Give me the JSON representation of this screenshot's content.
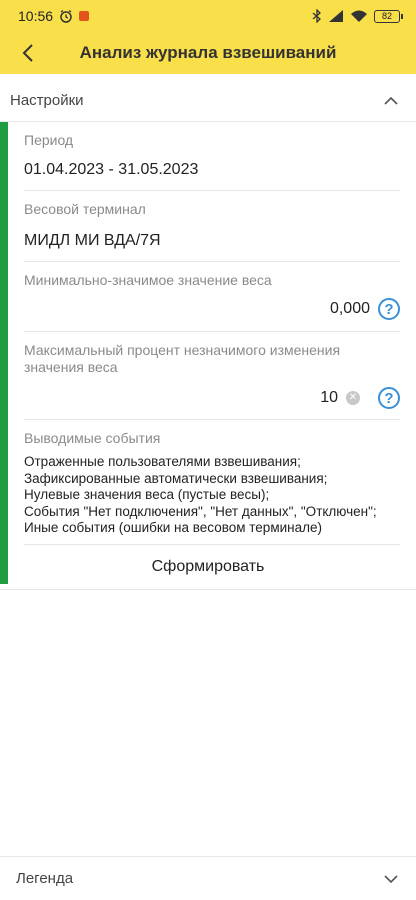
{
  "status_bar": {
    "time": "10:56",
    "battery": "82",
    "icons": [
      "alarm-icon",
      "app-notification-icon",
      "bluetooth-icon",
      "signal-icon",
      "wifi-icon",
      "battery-icon"
    ]
  },
  "header": {
    "title": "Анализ журнала взвешиваний"
  },
  "settings": {
    "title": "Настройки"
  },
  "fields": {
    "period": {
      "label": "Период",
      "value": "01.04.2023 - 31.05.2023"
    },
    "terminal": {
      "label": "Весовой терминал",
      "value": "МИДЛ МИ ВДА/7Я"
    },
    "min_weight": {
      "label": "Минимально-значимое значение веса",
      "value": "0,000"
    },
    "max_percent": {
      "label": "Максимальный процент незначимого изменения значения веса",
      "value": "10"
    },
    "events": {
      "label": "Выводимые события",
      "lines": [
        "Отраженные пользователями взвешивания;",
        "Зафиксированные автоматически взвешивания;",
        "Нулевые значения веса (пустые весы);",
        "События \"Нет подключения\", \"Нет данных\", \"Отключен\";",
        "Иные события (ошибки на весовом терминале)"
      ]
    }
  },
  "actions": {
    "form_button": "Сформировать"
  },
  "legend": {
    "title": "Легенда"
  },
  "colors": {
    "header_bg": "#f9e04b",
    "accent_green": "#1e9e3e",
    "help_blue": "#3b8fd9"
  }
}
